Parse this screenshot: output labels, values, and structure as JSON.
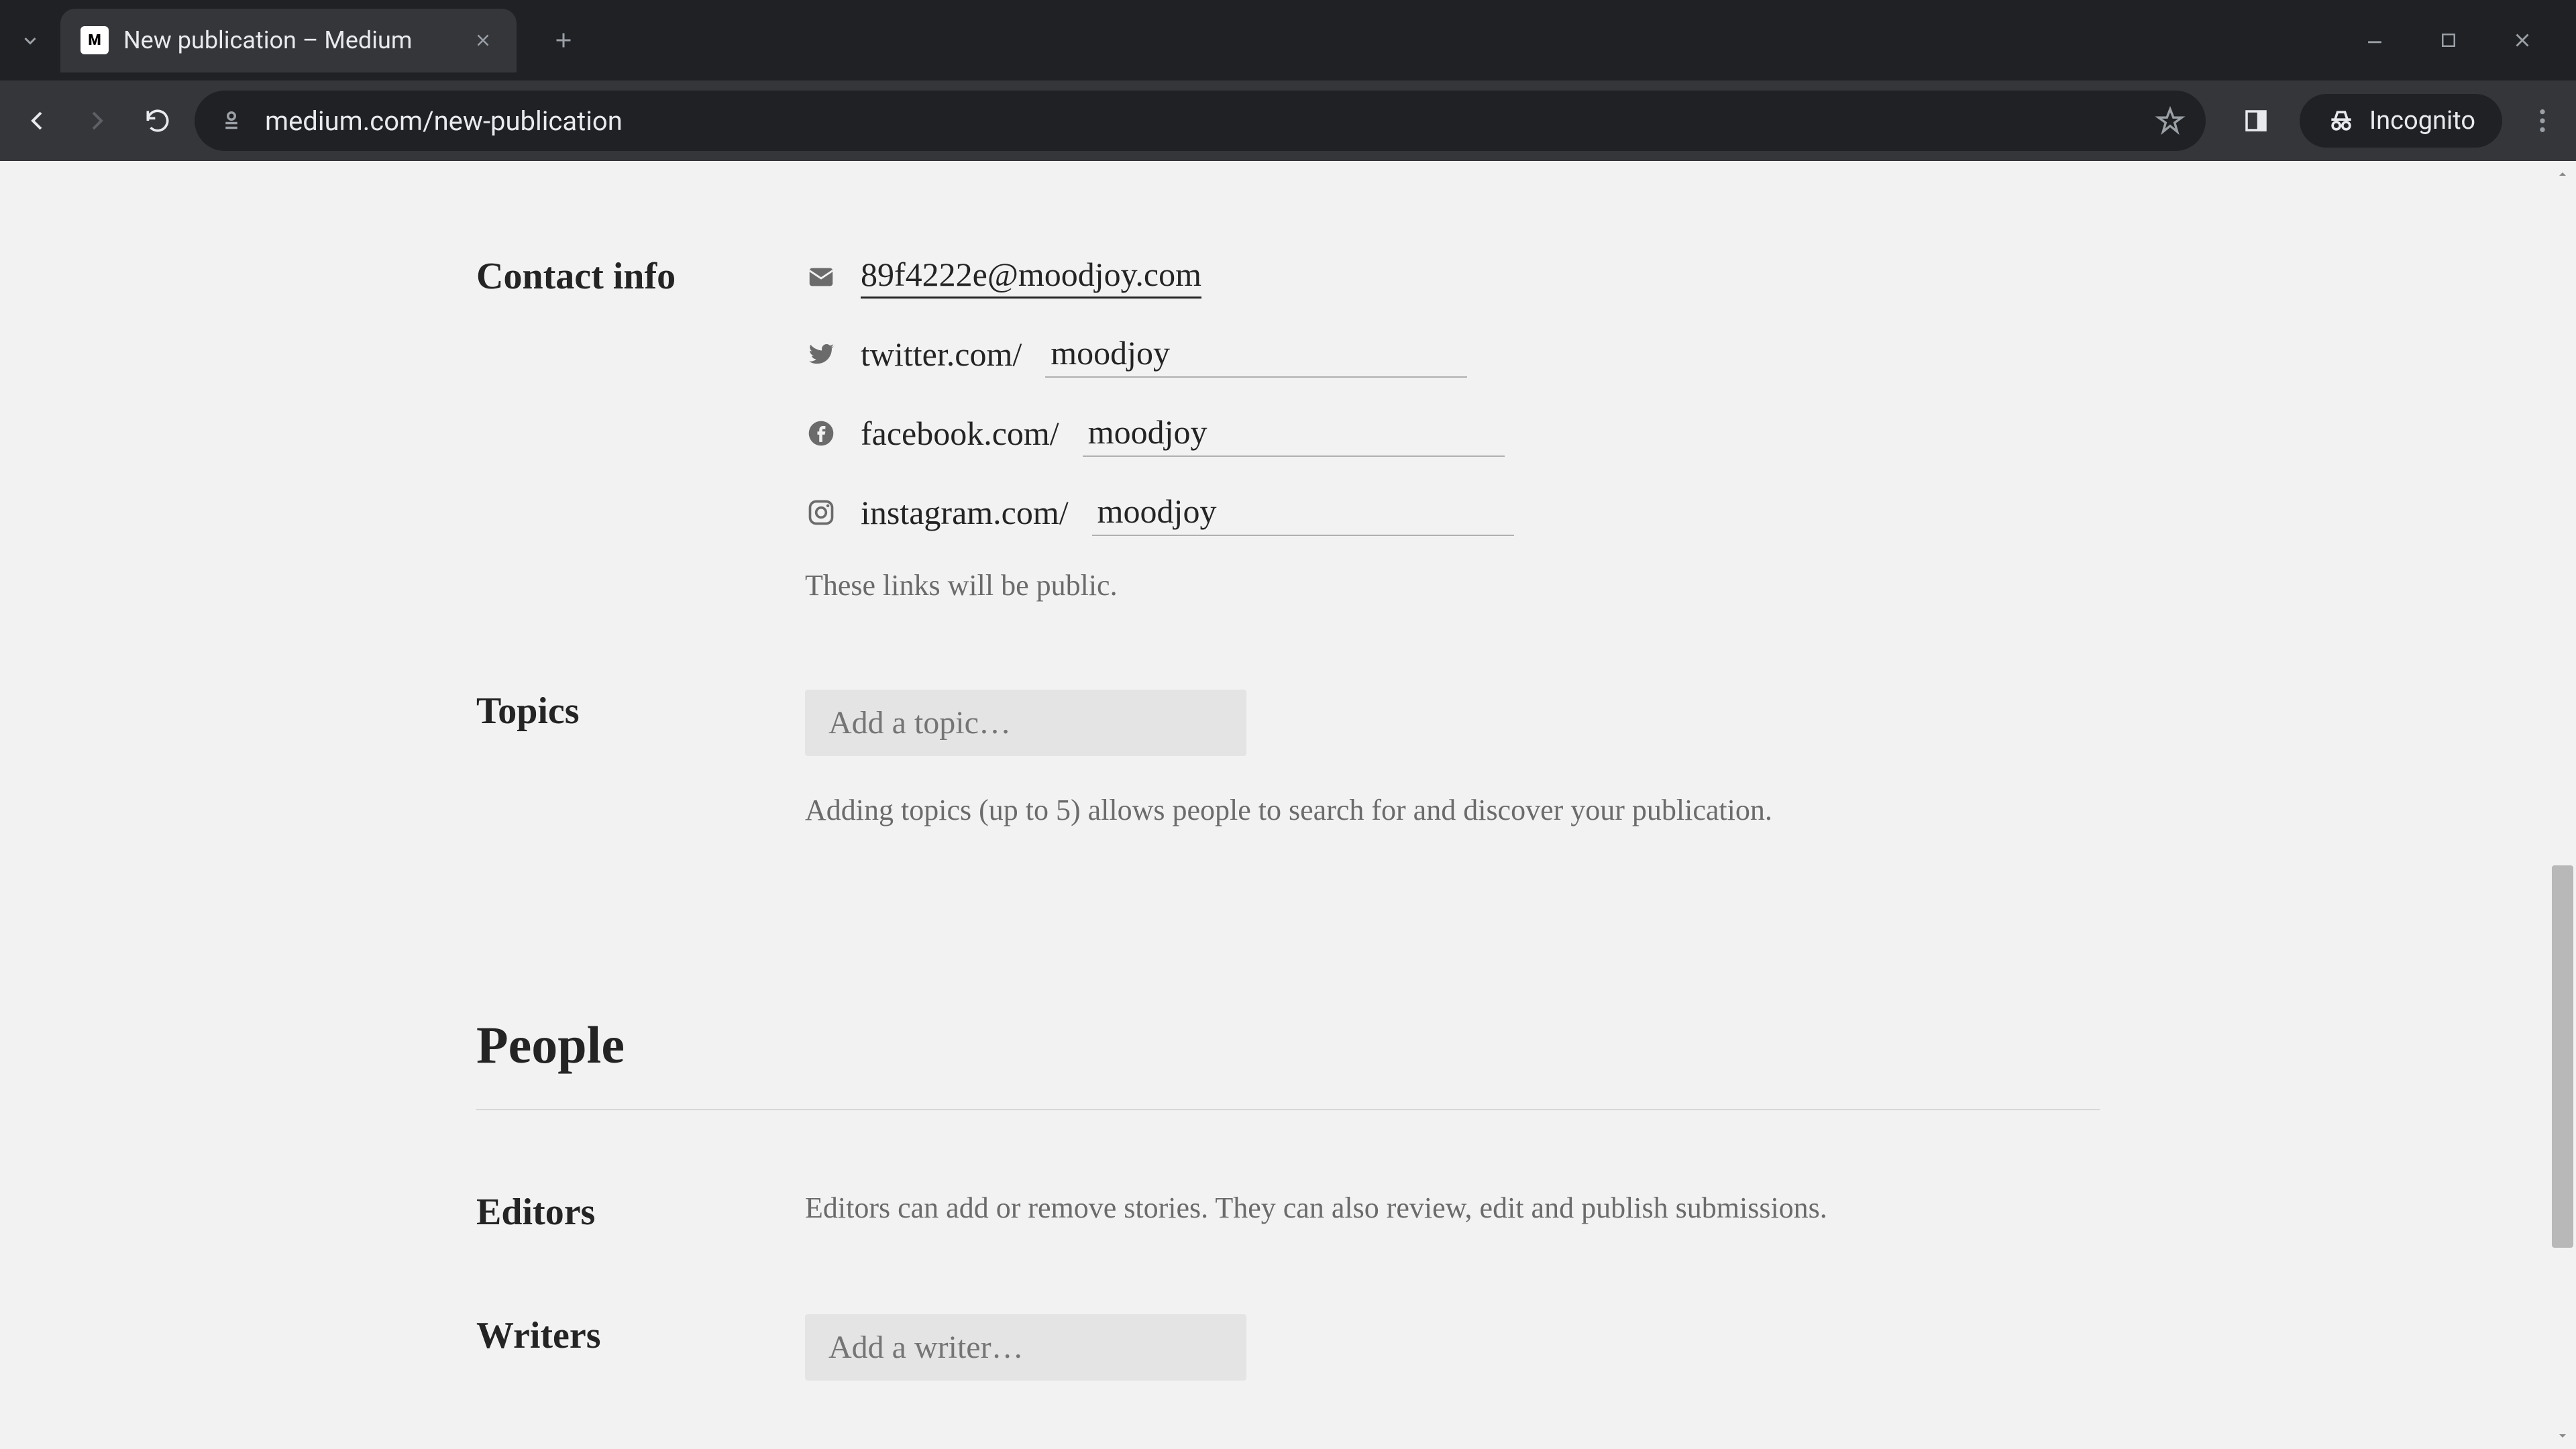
{
  "browser": {
    "tab_title": "New publication – Medium",
    "url_display": "medium.com/new-publication",
    "incognito_label": "Incognito"
  },
  "contact": {
    "heading": "Contact info",
    "email": "89f4222e@moodjoy.com",
    "twitter_prefix": "twitter.com/",
    "twitter_value": "moodjoy",
    "facebook_prefix": "facebook.com/",
    "facebook_value": "moodjoy",
    "instagram_prefix": "instagram.com/",
    "instagram_value": "moodjoy",
    "note": "These links will be public."
  },
  "topics": {
    "heading": "Topics",
    "placeholder": "Add a topic…",
    "help": "Adding topics (up to 5) allows people to search for and discover your publication."
  },
  "people": {
    "heading": "People",
    "editors_heading": "Editors",
    "editors_desc": "Editors can add or remove stories. They can also review, edit and publish submissions.",
    "writers_heading": "Writers",
    "writers_placeholder": "Add a writer…"
  }
}
